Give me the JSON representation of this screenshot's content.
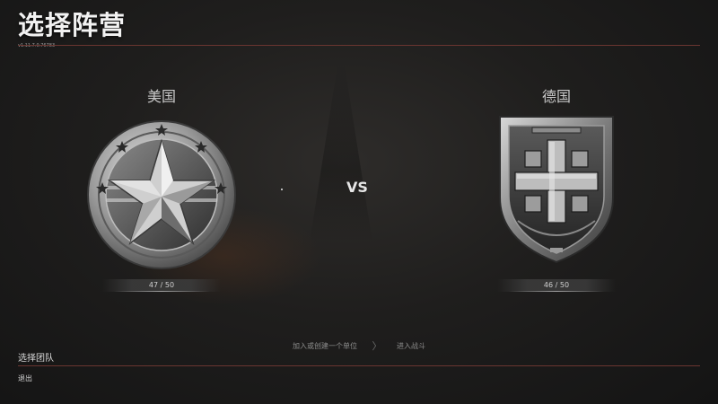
{
  "header": {
    "title": "选择阵营",
    "version": "v1.11.7.0.76783"
  },
  "factions": {
    "left": {
      "name": "美国",
      "count": "47 / 50",
      "emblem_icon": "us-star-emblem-icon"
    },
    "right": {
      "name": "德国",
      "count": "46 / 50",
      "emblem_icon": "german-cross-shield-icon"
    }
  },
  "vs_label": "VS",
  "steps": {
    "step1": "加入或创建一个单位",
    "separator": "〉",
    "step2": "进入战斗"
  },
  "footer": {
    "section_label": "选择团队",
    "exit_label": "退出"
  },
  "colors": {
    "accent_line": "#6a3530",
    "background": "#1f1e1d",
    "metal": "#9c9c9c"
  }
}
